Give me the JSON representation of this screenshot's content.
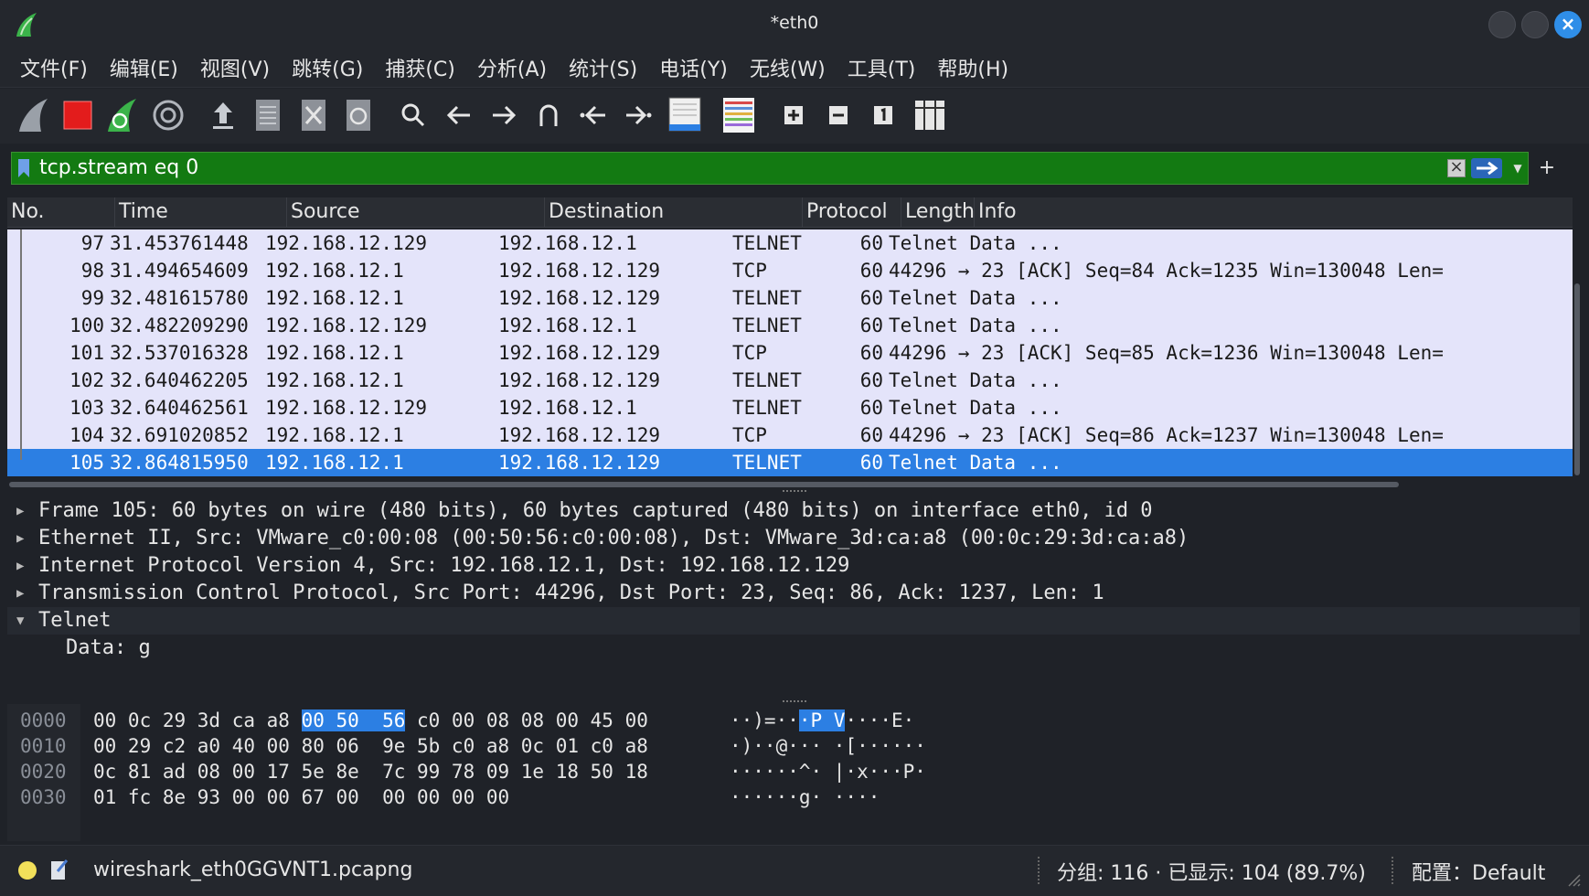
{
  "window": {
    "title": "*eth0"
  },
  "menu": [
    "文件(F)",
    "编辑(E)",
    "视图(V)",
    "跳转(G)",
    "捕获(C)",
    "分析(A)",
    "统计(S)",
    "电话(Y)",
    "无线(W)",
    "工具(T)",
    "帮助(H)"
  ],
  "filter": {
    "value": "tcp.stream eq 0",
    "plus": "+"
  },
  "columns": [
    "No.",
    "Time",
    "Source",
    "Destination",
    "Protocol",
    "Length",
    "Info"
  ],
  "packets": [
    {
      "no": "97",
      "time": "31.453761448",
      "src": "192.168.12.129",
      "dst": "192.168.12.1",
      "proto": "TELNET",
      "len": "60",
      "info": "Telnet Data ..."
    },
    {
      "no": "98",
      "time": "31.494654609",
      "src": "192.168.12.1",
      "dst": "192.168.12.129",
      "proto": "TCP",
      "len": "60",
      "info": "44296 → 23 [ACK] Seq=84 Ack=1235 Win=130048 Len="
    },
    {
      "no": "99",
      "time": "32.481615780",
      "src": "192.168.12.1",
      "dst": "192.168.12.129",
      "proto": "TELNET",
      "len": "60",
      "info": "Telnet Data ..."
    },
    {
      "no": "100",
      "time": "32.482209290",
      "src": "192.168.12.129",
      "dst": "192.168.12.1",
      "proto": "TELNET",
      "len": "60",
      "info": "Telnet Data ..."
    },
    {
      "no": "101",
      "time": "32.537016328",
      "src": "192.168.12.1",
      "dst": "192.168.12.129",
      "proto": "TCP",
      "len": "60",
      "info": "44296 → 23 [ACK] Seq=85 Ack=1236 Win=130048 Len="
    },
    {
      "no": "102",
      "time": "32.640462205",
      "src": "192.168.12.1",
      "dst": "192.168.12.129",
      "proto": "TELNET",
      "len": "60",
      "info": "Telnet Data ..."
    },
    {
      "no": "103",
      "time": "32.640462561",
      "src": "192.168.12.129",
      "dst": "192.168.12.1",
      "proto": "TELNET",
      "len": "60",
      "info": "Telnet Data ..."
    },
    {
      "no": "104",
      "time": "32.691020852",
      "src": "192.168.12.1",
      "dst": "192.168.12.129",
      "proto": "TCP",
      "len": "60",
      "info": "44296 → 23 [ACK] Seq=86 Ack=1237 Win=130048 Len="
    },
    {
      "no": "105",
      "time": "32.864815950",
      "src": "192.168.12.1",
      "dst": "192.168.12.129",
      "proto": "TELNET",
      "len": "60",
      "info": "Telnet Data ..."
    }
  ],
  "selected_packet_no": "105",
  "details": [
    "Frame 105: 60 bytes on wire (480 bits), 60 bytes captured (480 bits) on interface eth0, id 0",
    "Ethernet II, Src: VMware_c0:00:08 (00:50:56:c0:00:08), Dst: VMware_3d:ca:a8 (00:0c:29:3d:ca:a8)",
    "Internet Protocol Version 4, Src: 192.168.12.1, Dst: 192.168.12.129",
    "Transmission Control Protocol, Src Port: 44296, Dst Port: 23, Seq: 86, Ack: 1237, Len: 1",
    "Telnet",
    "Data: g"
  ],
  "bytes": [
    {
      "offset": "0000",
      "hex_a": "00 0c 29 3d ca a8 ",
      "hex_hl": "00 50  56",
      "hex_b": " c0 00 08 08 00 45 00",
      "asc_a": "··)=··",
      "asc_hl": "·P V",
      "asc_b": "····E·"
    },
    {
      "offset": "0010",
      "hex_a": "00 29 c2 a0 40 00 80 06  9e 5b c0 a8 0c 01 c0 a8",
      "hex_hl": "",
      "hex_b": "",
      "asc_a": "·)··@··· ·[······",
      "asc_hl": "",
      "asc_b": ""
    },
    {
      "offset": "0020",
      "hex_a": "0c 81 ad 08 00 17 5e 8e  7c 99 78 09 1e 18 50 18",
      "hex_hl": "",
      "hex_b": "",
      "asc_a": "······^· |·x···P·",
      "asc_hl": "",
      "asc_b": ""
    },
    {
      "offset": "0030",
      "hex_a": "01 fc 8e 93 00 00 67 00  00 00 00 00",
      "hex_hl": "",
      "hex_b": "",
      "asc_a": "······g· ····",
      "asc_hl": "",
      "asc_b": ""
    }
  ],
  "status": {
    "file": "wireshark_eth0GGVNT1.pcapng",
    "counts": "分组: 116 · 已显示: 104 (89.7%)",
    "profile": "配置：Default"
  },
  "colors": {
    "accent": "#2c7fe3",
    "filter_ok": "#137a12",
    "row_bg": "#e4e4fa"
  }
}
